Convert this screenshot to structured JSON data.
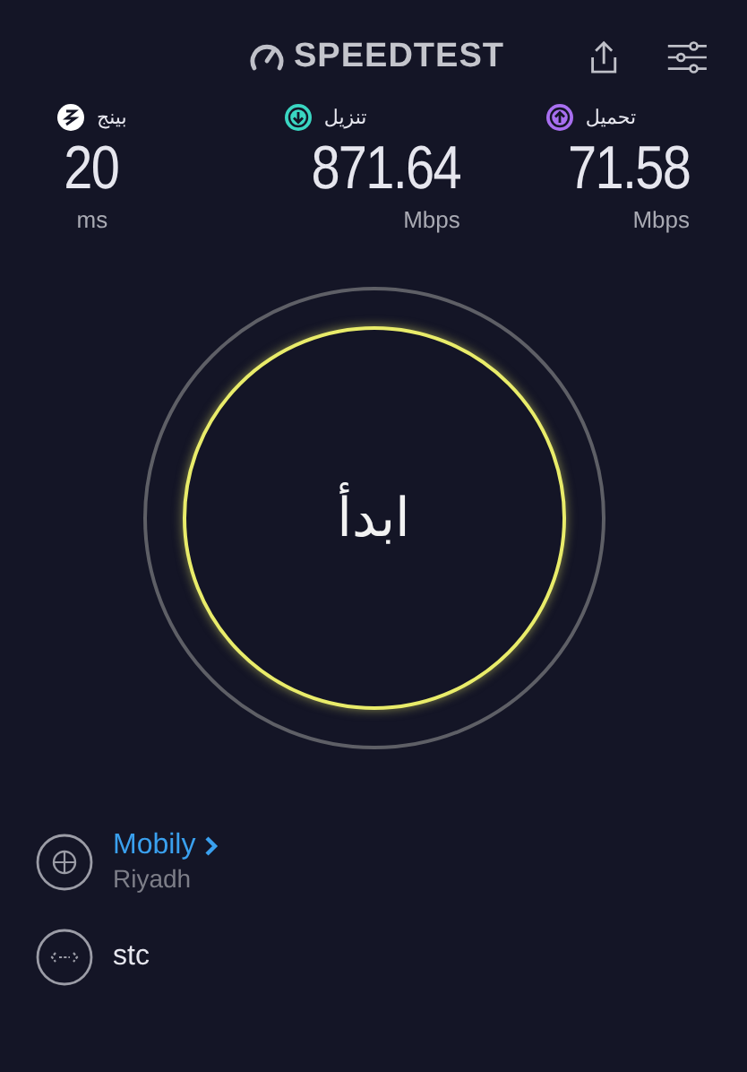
{
  "header": {
    "logo": "SPEEDTEST"
  },
  "metrics": [
    {
      "kind": "upload",
      "label": "تحميل",
      "value": "71.58",
      "unit": "Mbps",
      "color": "#a86ff0"
    },
    {
      "kind": "download",
      "label": "تنزيل",
      "value": "871.64",
      "unit": "Mbps",
      "color": "#3ad6c2"
    },
    {
      "kind": "ping",
      "label": "بينج",
      "value": "20",
      "unit": "ms",
      "color": "#ffffff"
    }
  ],
  "start_button": {
    "label": "ابدأ"
  },
  "provider": {
    "name": "Mobily",
    "location": "Riyadh"
  },
  "connection": {
    "name": "stc"
  }
}
